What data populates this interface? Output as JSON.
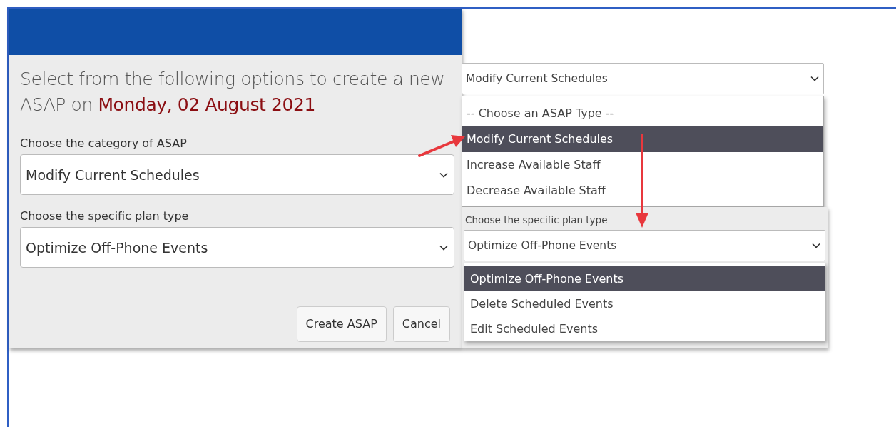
{
  "dialog": {
    "heading": "Select from the following options to create a new ASAP on **Monday, 02 August 2021**",
    "fields": [
      {
        "label": "Choose the category of ASAP",
        "value": "Modify Current Schedules"
      },
      {
        "label": "Choose the specific plan type",
        "value": "Optimize Off-Phone Events"
      }
    ],
    "buttons": [
      "Create ASAP",
      "Cancel"
    ]
  },
  "category_dropdown": {
    "value": "Modify Current Schedules",
    "options": [
      {
        "label": "-- Choose an ASAP Type --",
        "selected": false
      },
      {
        "label": "Modify Current Schedules",
        "selected": true
      },
      {
        "label": "Increase Available Staff",
        "selected": false
      },
      {
        "label": "Decrease Available Staff",
        "selected": false
      }
    ]
  },
  "plan_dropdown": {
    "label": "Choose the specific plan type",
    "value": "Optimize Off-Phone Events",
    "options": [
      {
        "label": "Optimize Off-Phone Events",
        "selected": true
      },
      {
        "label": "Delete Scheduled Events",
        "selected": false
      },
      {
        "label": "Edit Scheduled Events",
        "selected": false
      }
    ]
  }
}
